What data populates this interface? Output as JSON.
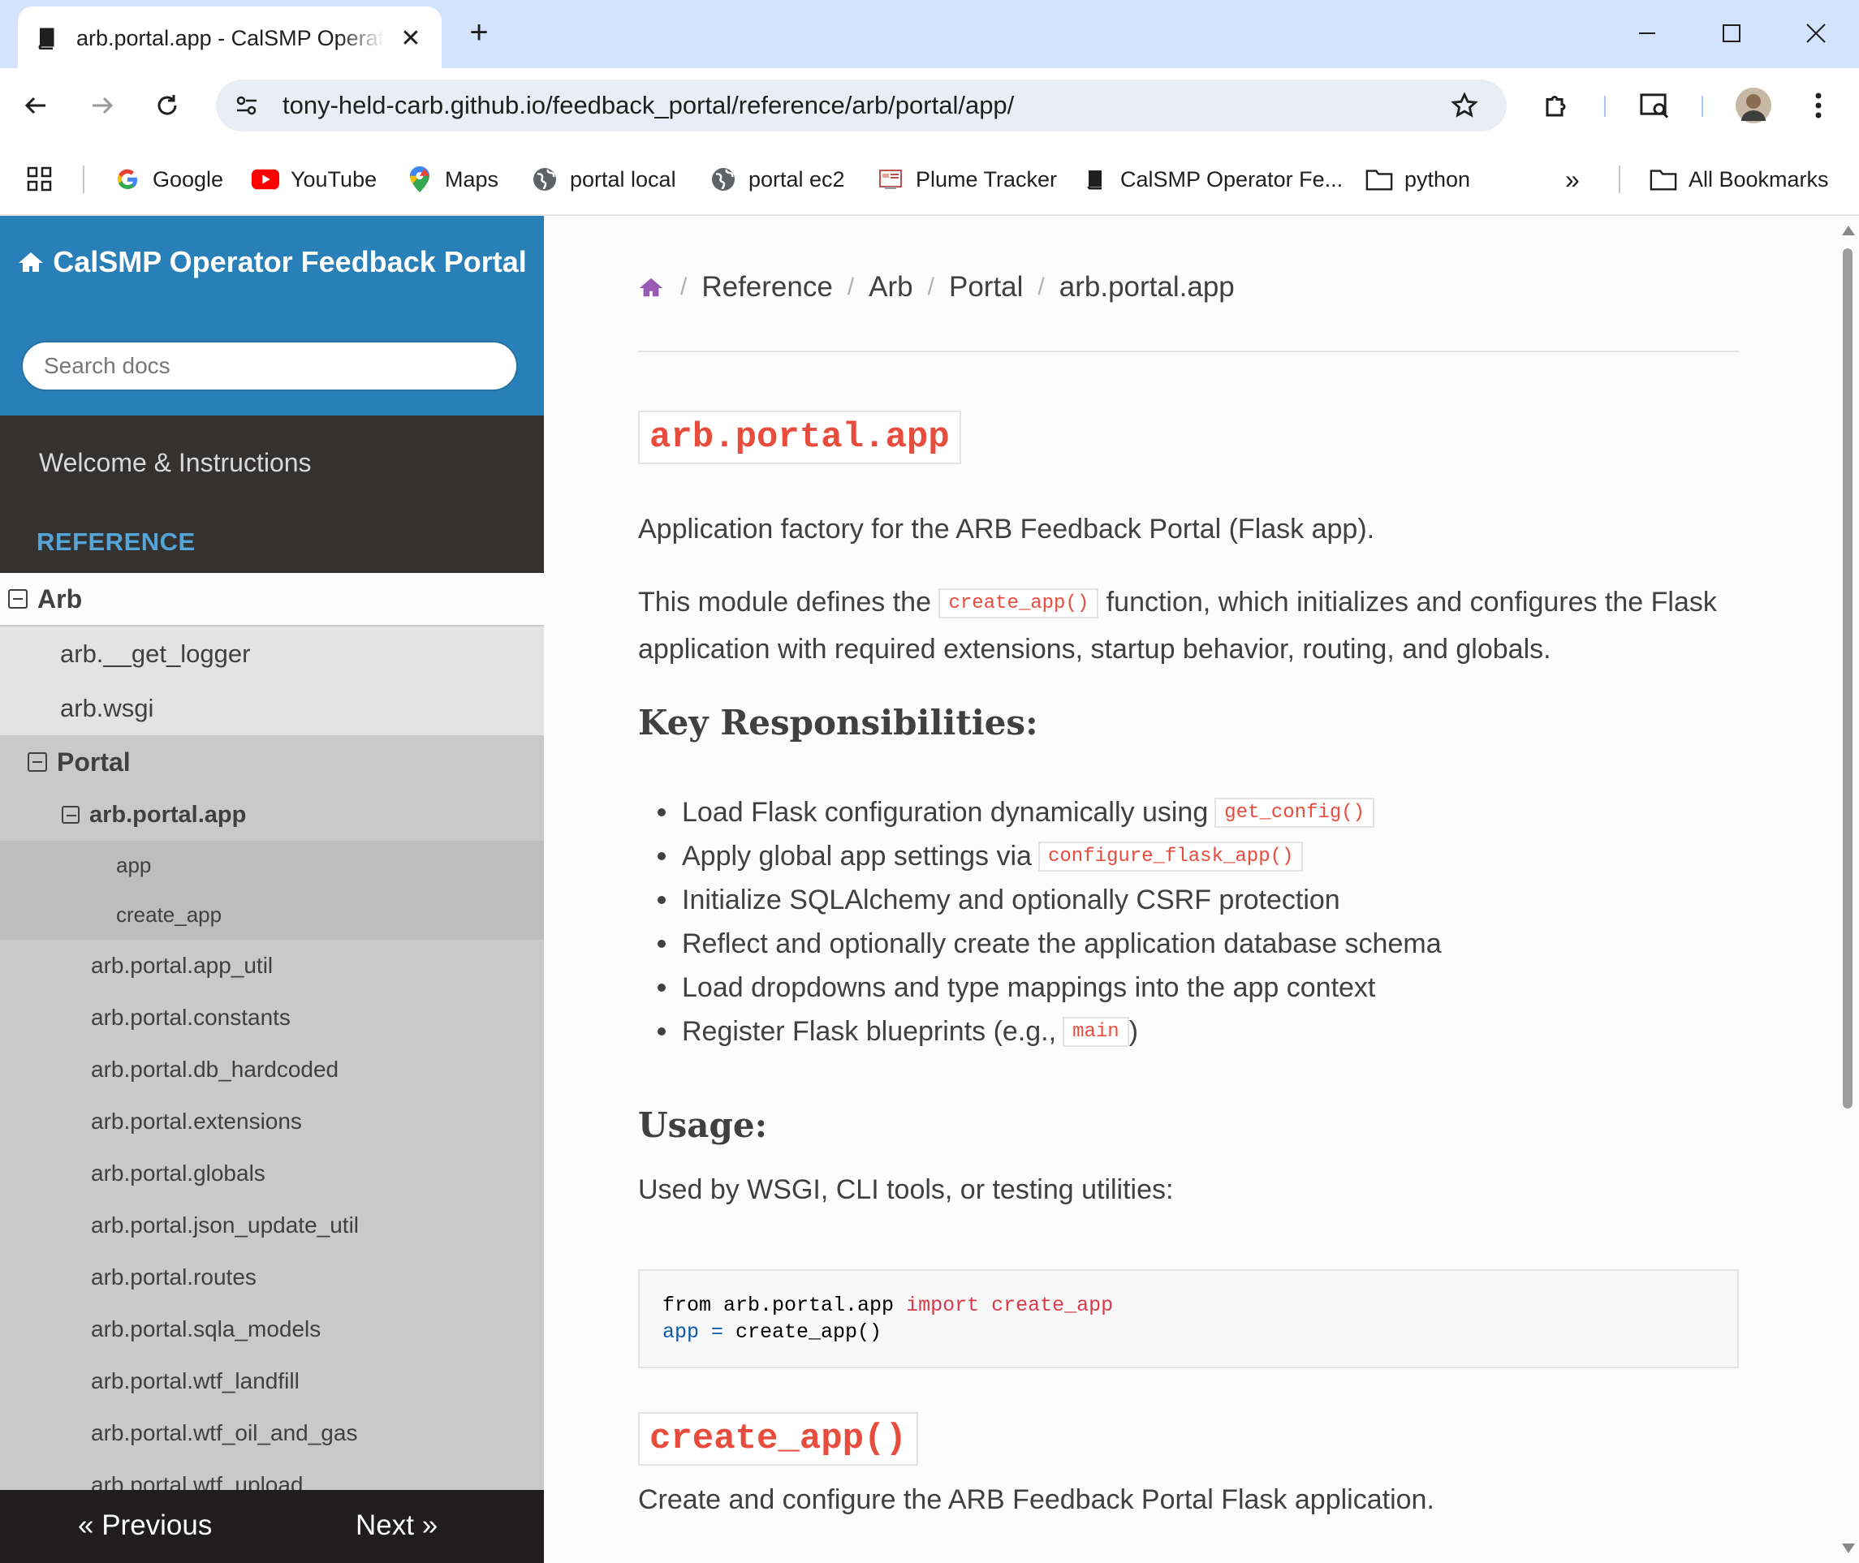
{
  "browser": {
    "tab_title": "arb.portal.app - CalSMP Operator Feedback Portal",
    "url": "tony-held-carb.github.io/feedback_portal/reference/arb/portal/app/",
    "bookmarks": [
      "Google",
      "YouTube",
      "Maps",
      "portal local",
      "portal ec2",
      "Plume Tracker",
      "CalSMP Operator Fe...",
      "python"
    ],
    "all_bookmarks": "All Bookmarks",
    "overflow": "»"
  },
  "sidebar": {
    "title": "CalSMP Operator Feedback Portal",
    "search_placeholder": "Search docs",
    "welcome": "Welcome & Instructions",
    "caption": "REFERENCE",
    "tree": {
      "arb": "Arb",
      "arb_children": [
        "arb.__get_logger",
        "arb.wsgi"
      ],
      "portal": "Portal",
      "portal_app": "arb.portal.app",
      "portal_app_children": [
        "app",
        "create_app"
      ],
      "portal_modules": [
        "arb.portal.app_util",
        "arb.portal.constants",
        "arb.portal.db_hardcoded",
        "arb.portal.extensions",
        "arb.portal.globals",
        "arb.portal.json_update_util",
        "arb.portal.routes",
        "arb.portal.sqla_models",
        "arb.portal.wtf_landfill",
        "arb.portal.wtf_oil_and_gas",
        "arb.portal.wtf_upload"
      ]
    },
    "prev": "« Previous",
    "next": "Next »"
  },
  "content": {
    "breadcrumbs": [
      "Reference",
      "Arb",
      "Portal",
      "arb.portal.app"
    ],
    "module_title": "arb.portal.app",
    "intro": "Application factory for the ARB Feedback Portal (Flask app).",
    "desc_pre": "This module defines the",
    "desc_code": "create_app()",
    "desc_post": "function, which initializes and configures the Flask application with required extensions, startup behavior, routing, and globals.",
    "key_heading": "Key Responsibilities:",
    "bullets": [
      {
        "text": "Load Flask configuration dynamically using",
        "code": "get_config()",
        "after": ""
      },
      {
        "text": "Apply global app settings via",
        "code": "configure_flask_app()",
        "after": ""
      },
      {
        "text": "Initialize SQLAlchemy and optionally CSRF protection",
        "code": "",
        "after": ""
      },
      {
        "text": "Reflect and optionally create the application database schema",
        "code": "",
        "after": ""
      },
      {
        "text": "Load dropdowns and type mappings into the app context",
        "code": "",
        "after": ""
      },
      {
        "text": "Register Flask blueprints (e.g.,",
        "code": "main",
        "after": ")"
      }
    ],
    "usage_heading": "Usage:",
    "usage_text": "Used by WSGI, CLI tools, or testing utilities:",
    "code_line1": {
      "a": "from arb.portal.app ",
      "b": "import create_app"
    },
    "code_line2": {
      "a": "app",
      "b": " = ",
      "c": "create_app()"
    },
    "func_title": "create_app()",
    "func_desc": "Create and configure the ARB Feedback Portal Flask application."
  },
  "colors": {
    "sidebar_header": "#2980b9",
    "sidebar_bg": "#343131",
    "code_red": "#e74c3c",
    "caption": "#55a5d9"
  }
}
